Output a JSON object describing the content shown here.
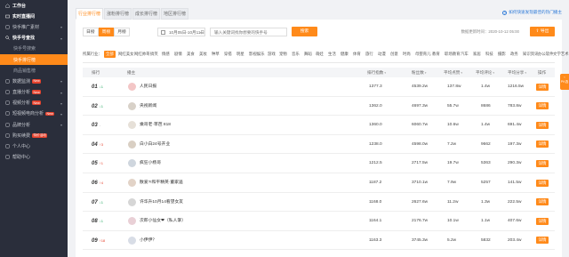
{
  "sidebar": {
    "items": [
      {
        "label": "工作台",
        "icon": "home-icon",
        "style": "bold"
      },
      {
        "label": "实时直播间",
        "icon": "live-icon",
        "style": "bold"
      },
      {
        "label": "快手推广素材",
        "icon": "material-icon",
        "style": "normal",
        "arrow": true
      },
      {
        "label": "快手号查找",
        "icon": "search-icon",
        "style": "bold",
        "arrow": true
      },
      {
        "label": "快手号搜索",
        "style": "sub"
      },
      {
        "label": "快手排行榜",
        "style": "sub-active"
      },
      {
        "label": "商品销售榜",
        "style": "sub"
      },
      {
        "label": "数据监测",
        "icon": "monitor-icon",
        "style": "normal",
        "tag": "New",
        "arrow": true
      },
      {
        "label": "直播分析",
        "icon": "live-analysis-icon",
        "style": "normal",
        "tag": "New",
        "arrow": true
      },
      {
        "label": "视频分析",
        "icon": "video-icon",
        "style": "normal",
        "tag": "New",
        "arrow": true
      },
      {
        "label": "短视频电商分析",
        "icon": "ecommerce-icon",
        "style": "normal",
        "tag": "New",
        "arrow": true
      },
      {
        "label": "品牌分析",
        "icon": "brand-icon",
        "style": "normal",
        "arrow": true
      },
      {
        "label": "购买续费",
        "icon": "cart-icon",
        "style": "normal",
        "tag": "特价活动"
      },
      {
        "label": "个人中心",
        "icon": "user-icon",
        "style": "normal"
      },
      {
        "label": "帮助中心",
        "icon": "help-icon",
        "style": "normal"
      }
    ]
  },
  "tabs": [
    {
      "label": "行业排行榜",
      "active": true
    },
    {
      "label": "涨粉排行榜",
      "active": false
    },
    {
      "label": "成长排行榜",
      "active": false
    },
    {
      "label": "地区排行榜",
      "active": false
    }
  ],
  "tip_link": "如何快速发现最佳的热门播主",
  "period_buttons": [
    {
      "label": "日榜",
      "active": false
    },
    {
      "label": "周榜",
      "active": true
    },
    {
      "label": "月榜",
      "active": false
    }
  ],
  "date_range": "10月05日-10月11日",
  "search": {
    "placeholder": "输入关键词找你想要的快手号",
    "button": "搜索"
  },
  "update_time": "数据更新时间：2020-10-12 05:00",
  "export_label": "导出",
  "categories_label": "所属行业：",
  "categories": [
    "全部",
    "网红美女",
    "网红帅哥",
    "搞笑",
    "情感",
    "剧情",
    "美食",
    "美妆",
    "种草",
    "穿搭",
    "明星",
    "影视娱乐",
    "游戏",
    "宠物",
    "音乐",
    "舞蹈",
    "萌娃",
    "生活",
    "健康",
    "体育",
    "旅行",
    "动漫",
    "创意",
    "时尚",
    "母婴育儿",
    "教育",
    "职场教育",
    "汽车",
    "家居",
    "科技",
    "摄影",
    "政务",
    "知识资讯",
    "办公软件",
    "文学艺术"
  ],
  "table": {
    "headers": [
      "排行",
      "播主",
      "排行指数",
      "粉丝数",
      "平均点赞",
      "平均评论",
      "平均分享",
      "操作"
    ],
    "rows": [
      {
        "rank": "01",
        "delta": "↓1",
        "dir": "down",
        "name": "人民日报",
        "index": "1377.3",
        "fans": "4539.2w",
        "likes": "137.8w",
        "comments": "1.4w",
        "shares": "1216.5w"
      },
      {
        "rank": "02",
        "delta": "↓1",
        "dir": "down",
        "name": "央视新闻",
        "index": "1362.0",
        "fans": "4697.3w",
        "likes": "55.7w",
        "comments": "8686",
        "shares": "783.8w"
      },
      {
        "rank": "03",
        "delta": "-",
        "dir": "flat",
        "name": "乘哥老·草芭 818",
        "index": "1360.0",
        "fans": "6060.7w",
        "likes": "10.6w",
        "comments": "1.4w",
        "shares": "691.4w"
      },
      {
        "rank": "04",
        "delta": "↑3",
        "dir": "up",
        "name": "白小白24号开业",
        "index": "1238.0",
        "fans": "4598.0w",
        "likes": "7.2w",
        "comments": "9662",
        "shares": "197.3w"
      },
      {
        "rank": "05",
        "delta": "↑1",
        "dir": "up",
        "name": "疯狂小杨哥",
        "index": "1212.5",
        "fans": "2717.5w",
        "likes": "19.7w",
        "comments": "5363",
        "shares": "290.3w"
      },
      {
        "rank": "06",
        "delta": "↑4",
        "dir": "up",
        "name": "散爱?!和平精英·董家遥",
        "index": "1187.2",
        "fans": "3710.1w",
        "likes": "7.9w",
        "comments": "5257",
        "shares": "141.5w"
      },
      {
        "rank": "07",
        "delta": "↓1",
        "dir": "down",
        "name": "许华升10月14看望女友",
        "index": "1168.0",
        "fans": "2627.6w",
        "likes": "11.2w",
        "comments": "1.3w",
        "shares": "222.5w"
      },
      {
        "rank": "08",
        "delta": "↓1",
        "dir": "down",
        "name": "次郎小仙女❤（私人掌）",
        "index": "1164.1",
        "fans": "2176.7w",
        "likes": "10.1w",
        "comments": "1.1w",
        "shares": "407.6w"
      },
      {
        "rank": "09",
        "delta": "↑18",
        "dir": "up",
        "name": "小伊伊？",
        "index": "1163.3",
        "fans": "3745.3w",
        "likes": "5.2w",
        "comments": "5832",
        "shares": "203.4w"
      }
    ],
    "detail_label": "详情"
  },
  "float_tab": "PK选",
  "colors": {
    "accent": "#ff8a1a",
    "sidebar_bg": "#2a2e3b",
    "link": "#2f7bd8"
  }
}
